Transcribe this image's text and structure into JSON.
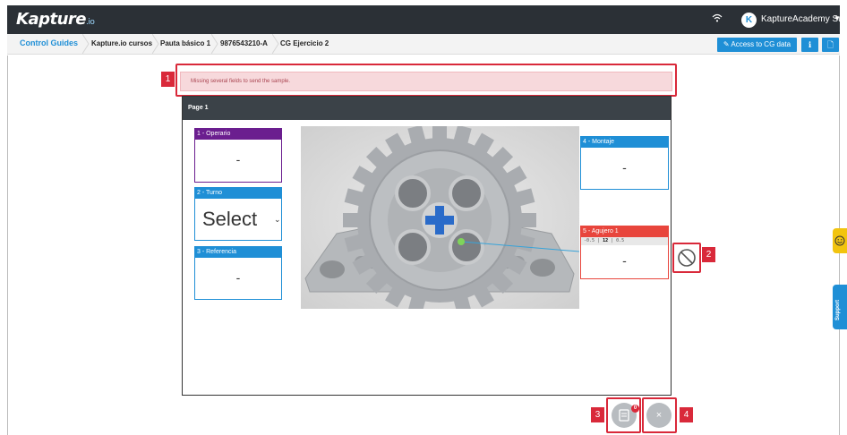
{
  "header": {
    "logo_text": "Kapture",
    "logo_suffix": ".io",
    "user_initial": "K",
    "user_name": "KaptureAcademy Support"
  },
  "breadcrumb": {
    "items": [
      "Control Guides",
      "Kapture.io cursos",
      "Pauta básico 1",
      "9876543210-A",
      "CG Ejercicio 2"
    ]
  },
  "toolbar": {
    "access_label": "Access to CG data",
    "btn_a_label": "ℹ",
    "btn_b_label": "🗋"
  },
  "alert": {
    "message": "Missing several fields to send the sample."
  },
  "markers": {
    "m1": "1",
    "m2": "2",
    "m3": "3",
    "m4": "4"
  },
  "page": {
    "title": "Page 1",
    "fields": [
      {
        "label": "1 - Operario",
        "value": "-",
        "color": "#6b1e8f"
      },
      {
        "label": "2 - Turno",
        "value": "Select",
        "color": "#1f8fd6"
      },
      {
        "label": "3 - Referencia",
        "value": "-",
        "color": "#1f8fd6"
      },
      {
        "label": "4 - Montaje",
        "value": "-",
        "color": "#1f8fd6"
      },
      {
        "label": "5 - Agujero 1",
        "value": "-",
        "color": "#e8453c",
        "tol_low": "-0.5",
        "tol_nom": "12",
        "tol_high": "0.5"
      }
    ]
  },
  "fab": {
    "badge": "0",
    "close_label": "×"
  },
  "side": {
    "support_label": "Support"
  }
}
